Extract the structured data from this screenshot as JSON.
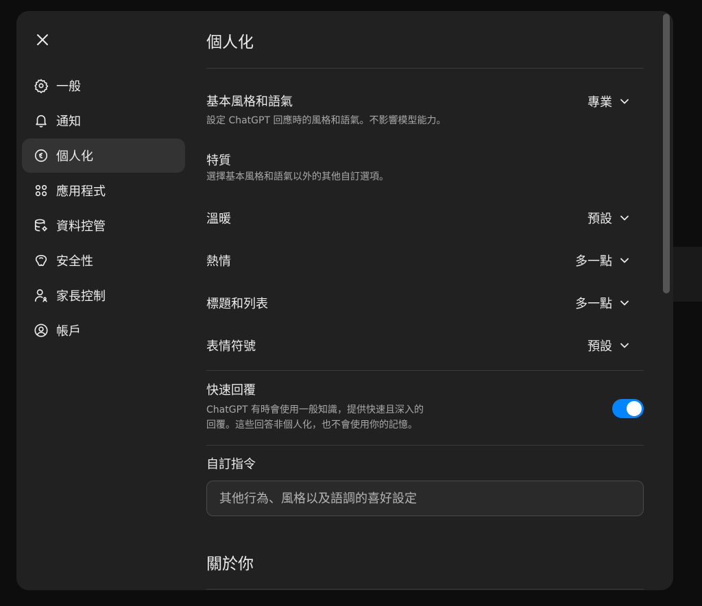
{
  "sidebar": {
    "items": [
      {
        "label": "一般",
        "icon": "gear-icon"
      },
      {
        "label": "通知",
        "icon": "bell-icon"
      },
      {
        "label": "個人化",
        "icon": "personalization-icon"
      },
      {
        "label": "應用程式",
        "icon": "apps-grid-icon"
      },
      {
        "label": "資料控管",
        "icon": "database-gear-icon"
      },
      {
        "label": "安全性",
        "icon": "security-icon"
      },
      {
        "label": "家長控制",
        "icon": "parent-user-icon"
      },
      {
        "label": "帳戶",
        "icon": "account-circle-icon"
      }
    ],
    "active_index": 2
  },
  "main": {
    "title": "個人化",
    "base_style": {
      "label": "基本風格和語氣",
      "description": "設定 ChatGPT 回應時的風格和語氣。不影響模型能力。",
      "value": "專業"
    },
    "traits": {
      "label": "特質",
      "description": "選擇基本風格和語氣以外的其他自訂選項。"
    },
    "warmth": {
      "label": "溫暖",
      "value": "預設"
    },
    "enthusiasm": {
      "label": "熱情",
      "value": "多一點"
    },
    "headers_lists": {
      "label": "標題和列表",
      "value": "多一點"
    },
    "emoji": {
      "label": "表情符號",
      "value": "預設"
    },
    "quick_reply": {
      "label": "快速回覆",
      "description_line1": "ChatGPT 有時會使用一般知識，提供快速且深入的",
      "description_line2": "回覆。這些回答非個人化，也不會使用你的記憶。",
      "enabled": true
    },
    "custom_instructions": {
      "label": "自訂指令",
      "placeholder": "其他行為、風格以及語調的喜好設定"
    },
    "about_you": {
      "title": "關於你"
    }
  },
  "colors": {
    "modal_bg": "#212121",
    "active_item_bg": "#333333",
    "toggle_on": "#0285ff",
    "secondary_text": "#a8a8a8"
  }
}
